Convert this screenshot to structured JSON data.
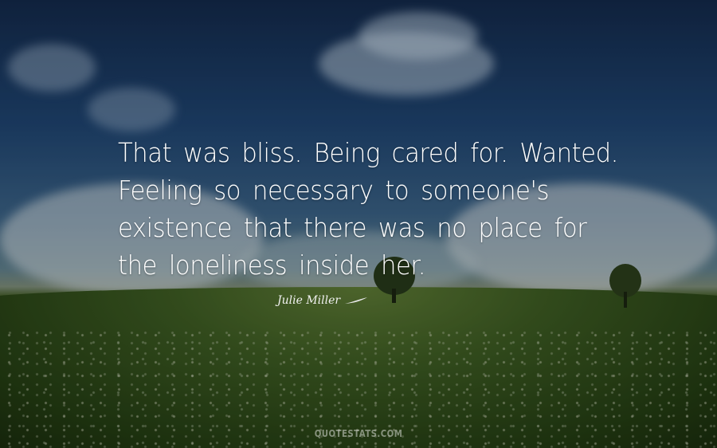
{
  "quote": {
    "lines": [
      "That was bliss. Being cared for. Wanted.",
      "Feeling so necessary to someone's",
      "existence that there was no place for",
      "the loneliness inside her."
    ]
  },
  "author": "Julie Miller",
  "watermark": "QUOTESTATS.COM",
  "colors": {
    "sky": "#1f4470",
    "grass": "#3c5a22",
    "text": "#ffffff"
  }
}
